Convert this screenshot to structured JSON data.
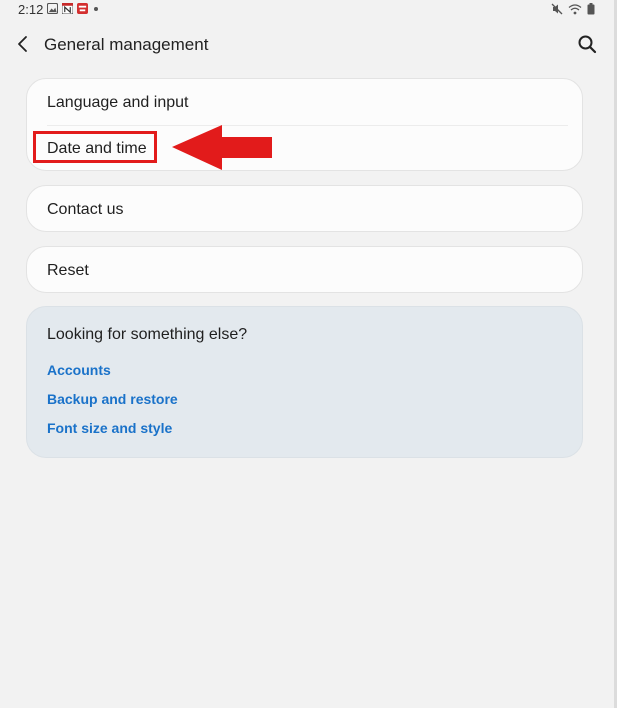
{
  "status_bar": {
    "time": "2:12",
    "left_icons": [
      "gallery-icon",
      "news-icon",
      "app-badge-icon",
      "notification-dot"
    ],
    "right_icons": [
      "mute-icon",
      "wifi-icon",
      "battery-icon"
    ]
  },
  "header": {
    "title": "General management",
    "back_icon": "chevron-left-icon",
    "search_icon": "search-icon"
  },
  "settings_groups": [
    {
      "items": [
        {
          "label": "Language and input"
        },
        {
          "label": "Date and time"
        }
      ]
    },
    {
      "items": [
        {
          "label": "Contact us"
        }
      ]
    },
    {
      "items": [
        {
          "label": "Reset"
        }
      ]
    }
  ],
  "suggestions": {
    "title": "Looking for something else?",
    "links": [
      {
        "label": "Accounts"
      },
      {
        "label": "Backup and restore"
      },
      {
        "label": "Font size and style"
      }
    ]
  },
  "annotation": {
    "highlight_color": "#e21b1b"
  },
  "colors": {
    "background": "#f2f2f2",
    "card": "#fcfcfc",
    "suggest_card": "#e3e9ee",
    "link": "#1a72c9"
  }
}
